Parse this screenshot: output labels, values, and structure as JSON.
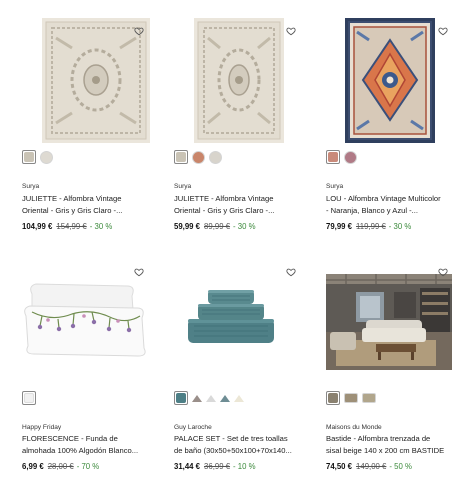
{
  "products": [
    {
      "brand": "Surya",
      "title_line1": "JULIETTE - Alfombra Vintage",
      "title_line2": "Oriental - Gris y Gris Claro -...",
      "price": "104,99 €",
      "old_price": "154,99 €",
      "discount": "- 30 %",
      "image": "beige-vintage-rug",
      "swatch_colors": [
        "#c9c3b5",
        "#dedad2"
      ]
    },
    {
      "brand": "Surya",
      "title_line1": "JULIETTE - Alfombra Vintage",
      "title_line2": "Oriental - Gris y Gris Claro -...",
      "price": "59,99 €",
      "old_price": "89,99 €",
      "discount": "- 30 %",
      "image": "beige-vintage-rug",
      "swatch_colors": [
        "#c9c3b5",
        "#c9856a",
        "#d8d4cc"
      ]
    },
    {
      "brand": "Surya",
      "title_line1": "LOU - Alfombra Vintage Multicolor",
      "title_line2": "- Naranja, Blanco y Azul -...",
      "price": "79,99 €",
      "old_price": "119,99 €",
      "discount": "- 30 %",
      "image": "multicolor-medallion-rug",
      "swatch_colors": [
        "#c98a7a",
        "#b07a86"
      ]
    },
    {
      "brand": "Happy Friday",
      "title_line1": "FLORESCENCE - Funda de",
      "title_line2": "almohada 100% Algodón Blanco...",
      "price": "6,99 €",
      "old_price": "28,00 €",
      "discount": "- 70 %",
      "image": "floral-pillowcases",
      "swatch_colors": [
        "#f1f1f1"
      ]
    },
    {
      "brand": "Guy Laroche",
      "title_line1": "PALACE SET - Set de tres toallas",
      "title_line2": "de baño (30x50+50x100+70x140...",
      "price": "31,44 €",
      "old_price": "36,99 €",
      "discount": "- 10 %",
      "image": "teal-towel-set",
      "swatch_colors": [
        "#4d7f86",
        "#9a8f8a",
        "#d9d9d9",
        "#6e8d94",
        "#ece7d6"
      ]
    },
    {
      "brand": "Maisons du Monde",
      "title_line1": "Bastide - Alfombra trenzada de",
      "title_line2": "sisal beige 140 x 200 cm BASTIDE",
      "price": "74,50 €",
      "old_price": "149,00 €",
      "discount": "- 50 %",
      "image": "living-room-sisal-rug",
      "swatch_colors": [
        "#8a8170",
        "#9e9078",
        "#b1a68c"
      ]
    }
  ],
  "favorite_icon": "heart-outline-icon",
  "accent_discount_color": "#3c8a3c"
}
